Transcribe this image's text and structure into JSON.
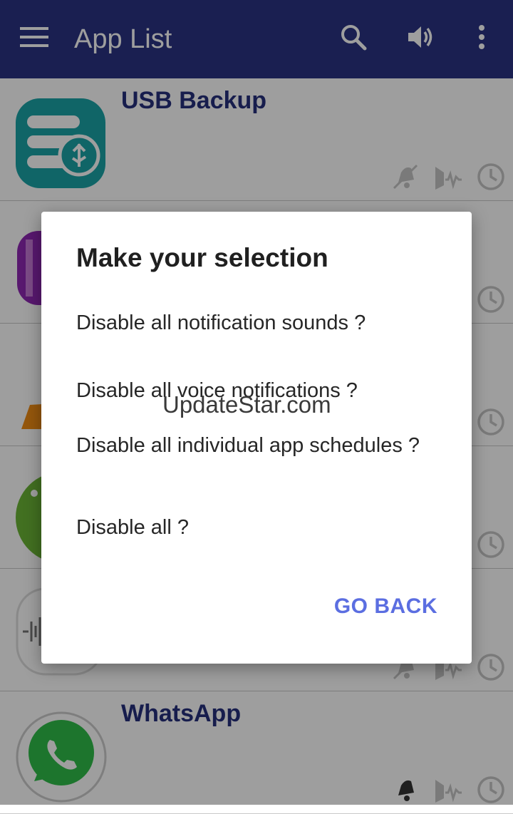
{
  "app_bar": {
    "title": "App List",
    "icons": [
      "menu-icon",
      "search-icon",
      "volume-icon",
      "more-vert-icon"
    ],
    "background": "#2a3383"
  },
  "apps": [
    {
      "name": "USB Backup",
      "icon": "usb-backup-app-icon",
      "actions": [
        "notification-bell-icon",
        "voice-wave-icon",
        "clock-icon"
      ]
    },
    {
      "name": "",
      "icon": "video-app-icon",
      "actions": [
        "clock-icon"
      ]
    },
    {
      "name": "",
      "icon": "orange-app-icon",
      "actions": [
        "clock-icon"
      ]
    },
    {
      "name": "",
      "icon": "android-app-icon",
      "actions": [
        "clock-icon"
      ]
    },
    {
      "name": "",
      "icon": "voice-recorder-app-icon",
      "actions": [
        "notification-bell-icon",
        "voice-wave-icon",
        "clock-icon"
      ]
    },
    {
      "name": "WhatsApp",
      "icon": "whatsapp-app-icon",
      "actions": [
        "notification-bell-icon",
        "voice-wave-icon",
        "clock-icon"
      ]
    }
  ],
  "dialog": {
    "title": "Make your selection",
    "options": [
      "Disable all notification sounds ?",
      "Disable all voice notifications ?",
      "Disable all individual app schedules ?",
      "Disable all ?"
    ],
    "go_back": "GO BACK",
    "accent": "#5b6ee1"
  },
  "watermark": "UpdateStar.com"
}
